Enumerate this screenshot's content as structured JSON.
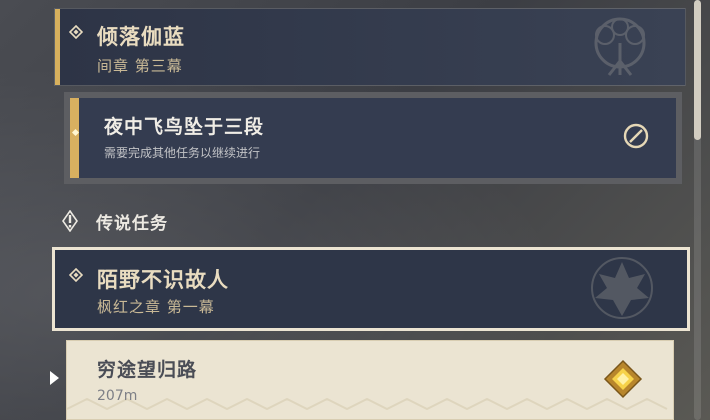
{
  "chapter_archon": {
    "title": "倾落伽蓝",
    "subtitle": "间章 第三幕",
    "icon": "chapter-diamond-icon",
    "emblem": "tree-emblem-icon"
  },
  "quest_archon": {
    "title": "夜中飞鸟坠于三段",
    "status": "需要完成其他任务以继续进行",
    "icon": "blocked-icon"
  },
  "section": {
    "title": "传说任务",
    "icon": "legend-quest-icon"
  },
  "chapter_legend": {
    "title": "陌野不识故人",
    "subtitle": "枫红之章 第一幕",
    "icon": "chapter-diamond-icon",
    "emblem": "maple-leaf-emblem-icon"
  },
  "quest_legend": {
    "title": "穷途望归路",
    "distance": "207m",
    "icon": "waypoint-diamond-icon"
  },
  "colors": {
    "accent_gold": "#d8b060",
    "card_dark": "#2e3648",
    "card_light": "#ebe4d2"
  }
}
